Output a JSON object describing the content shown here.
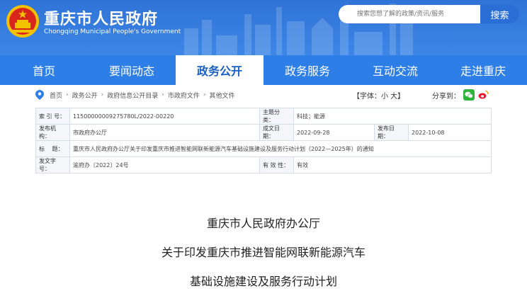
{
  "header": {
    "title": "重庆市人民政府",
    "subtitle": "Chongqing Municipal People's Government",
    "search_placeholder": "搜索您想了解的政策/资讯/服务",
    "search_button": "搜索"
  },
  "nav": [
    "首页",
    "要闻动态",
    "政务公开",
    "政务服务",
    "互动交流",
    "走进重庆"
  ],
  "breadcrumb": [
    "首页",
    "政务公开",
    "政府信息公开目录",
    "市政府文件",
    "其他文件"
  ],
  "font_size": "【字体：小 大】",
  "share_label": "分享到：",
  "info": {
    "index_label": "索 引 号：",
    "index_value": "11500000009275780L/2022-00220",
    "topic_label": "主题分类：",
    "topic_value": "科技；能源",
    "issuer_label": "发布机构：",
    "issuer_value": "市政府办公厅",
    "written_label": "成文日期：",
    "written_value": "2022-09-28",
    "published_label": "发布日期：",
    "published_value": "2022-10-08",
    "title_label": "标　 题：",
    "title_value": "重庆市人民政府办公厅关于印发重庆市推进智能网联新能源汽车基础设施建设及服务行动计划（2022—2025年）的通知",
    "docno_label": "发文字号：",
    "docno_value": "渝府办〔2022〕24号",
    "validity_label": "有 效 性：",
    "validity_value": "有效"
  },
  "doc_title": [
    "重庆市人民政府办公厅",
    "关于印发重庆市推进智能网联新能源汽车",
    "基础设施建设及服务行动计划"
  ]
}
